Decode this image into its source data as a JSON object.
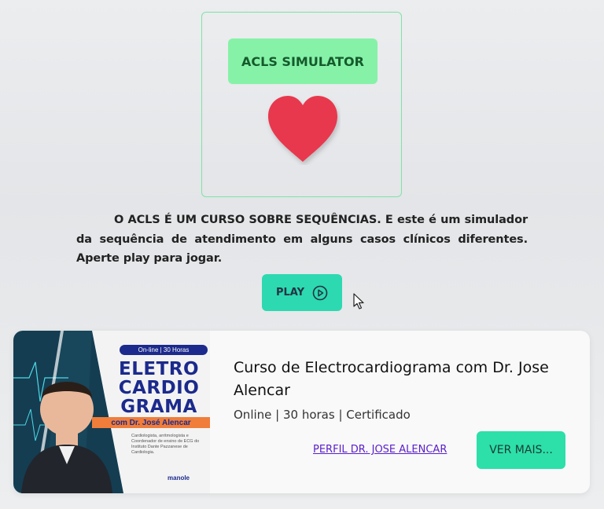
{
  "simulator": {
    "title": "ACLS SIMULATOR",
    "heart_icon": "heart-icon",
    "description": "O ACLS É UM CURSO SOBRE SEQUÊNCIAS. E este é um simulador da sequência de atendimento em alguns casos clínicos diferentes. Aperte play para jogar.",
    "play_label": "PLAY",
    "play_icon": "play-circle-icon"
  },
  "course": {
    "title": "Curso de Electrocardiograma com Dr. Jose Alencar",
    "meta": "Online | 30 horas | Certificado",
    "profile_link": "PERFIL DR. JOSE ALENCAR",
    "more_label": "VER MAIS...",
    "banner": {
      "pill": "On-line | 30 Horas",
      "line1": "ELETRO",
      "line2": "CARDIO",
      "line3": "GRAMA",
      "subtitle": "com Dr. José Alencar",
      "small_text": "Cardiologista, arritmologista e Coordenador de ensino de ECG do Instituto Dante Pazzanese de Cardiologia.",
      "logo": "manole"
    }
  },
  "colors": {
    "accent": "#2dd9b0",
    "title_bg": "#86f2a8",
    "heart": "#e8394d",
    "link": "#5a1ec8",
    "banner_blue": "#1b2a8c",
    "banner_orange": "#f07d3a"
  }
}
